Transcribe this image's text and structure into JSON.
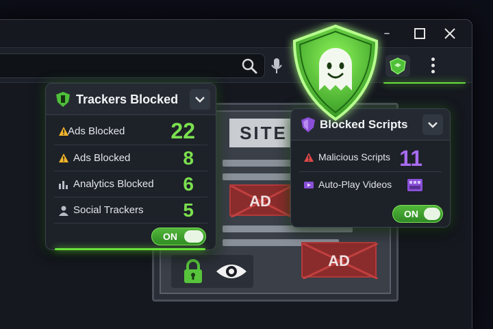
{
  "trackers_panel": {
    "title": "Trackers Blocked",
    "rows": [
      {
        "label": "Ads Blocked",
        "value": "22",
        "icon": "warning-icon"
      },
      {
        "label": "Ads Blocked",
        "value": "8",
        "icon": "warning-icon"
      },
      {
        "label": "Analytics Blocked",
        "value": "6",
        "icon": "bar-chart-icon"
      },
      {
        "label": "Social Trackers",
        "value": "5",
        "icon": "person-icon"
      }
    ],
    "toggle_label": "ON"
  },
  "scripts_panel": {
    "title": "Blocked Scripts",
    "rows": [
      {
        "label": "Malicious Scripts",
        "value": "11",
        "icon": "warning-icon"
      },
      {
        "label": "Auto-Play Videos",
        "icon": "video-icon"
      }
    ],
    "toggle_label": "ON"
  },
  "website": {
    "title": "SITE",
    "ad_labels": [
      "AD",
      "AD"
    ]
  },
  "colors": {
    "accent_green": "#6ae23a",
    "count_purple": "#a86cf0",
    "ad_red": "#8b2c2c"
  }
}
